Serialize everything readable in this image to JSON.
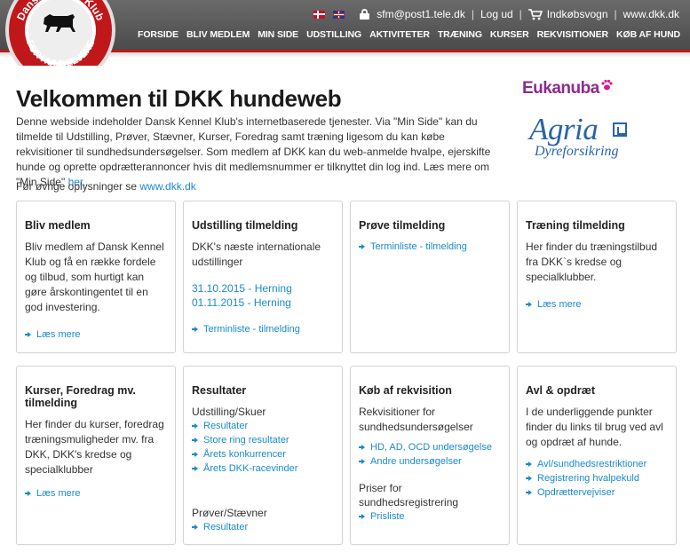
{
  "header": {
    "logo_text_top": "Dansk Kennel Klub",
    "logo_text_bottom": "FOR HUNDEEJERE",
    "user_email": "sfm@post1.tele.dk",
    "logout": "Log ud",
    "cart": "Indkøbsvogn",
    "site": "www.dkk.dk",
    "nav": [
      "FORSIDE",
      "BLIV MEDLEM",
      "MIN SIDE",
      "UDSTILLING",
      "AKTIVITETER",
      "TRÆNING",
      "KURSER",
      "REKVISITIONER",
      "KØB AF HUND"
    ]
  },
  "sponsors": {
    "eukanuba": "Eukanuba",
    "agria": "Agria",
    "agria_sub": "Dyreforsikring"
  },
  "main": {
    "title": "Velkommen til DKK hundeweb",
    "intro": "Denne webside indeholder Dansk Kennel Klub's internetbaserede tjenester. Via \"Min Side\" kan du tilmelde til Udstilling, Prøver, Stævner, Kurser, Foredrag samt træning ligesom du kan købe rekvisitioner til sundhedsundersøgelser. Som medlem af DKK kan du web-anmelde hvalpe, ejerskifte hunde og oprette opdrætterannoncer hvis dit medlemsnummer er tilknyttet din log ind. Læs mere om \"Min Side\"",
    "intro_link": "her.",
    "more_text": "Før øvrige oplysninger se",
    "more_link": "www.dkk.dk"
  },
  "cards": {
    "bliv": {
      "title": "Bliv medlem",
      "text": "Bliv medlem af Dansk Kennel Klub og få en række fordele og tilbud, som hurtigt kan gøre årskontingentet til en god investering.",
      "link": "Læs mere"
    },
    "udst": {
      "title": "Udstilling tilmelding",
      "text": "DKK's næste internationale udstillinger",
      "date1": "31.10.2015 - Herning",
      "date2": "01.11.2015 - Herning",
      "link": "Terminliste - tilmelding"
    },
    "prove": {
      "title": "Prøve tilmelding",
      "link": "Terminliste - tilmelding"
    },
    "traen": {
      "title": "Træning tilmelding",
      "text": "Her finder du træningstilbud fra DKK`s kredse og specialklubber.",
      "link": "Læs mere"
    },
    "kurser": {
      "title": "Kurser, Foredrag mv. tilmelding",
      "text": "Her finder du kurser, foredrag træningsmuligheder mv. fra DKK, DKK's kredse og specialklubber",
      "link": "Læs mere"
    },
    "result": {
      "title": "Resultater",
      "sub1": "Udstilling/Skuer",
      "links1": [
        "Resultater",
        "Store ring resultater",
        "Årets konkurrencer",
        "Årets DKK-racevinder"
      ],
      "sub2": "Prøver/Stævner",
      "links2": [
        "Resultater"
      ]
    },
    "kob": {
      "title": "Køb af rekvisition",
      "text": "Rekvisitioner for sundhedsundersøgelser",
      "links1": [
        "HD, AD, OCD undersøgelse",
        "Andre undersøgelser"
      ],
      "sub2": "Priser for sundhedsregistrering",
      "links2": [
        "Prisliste"
      ]
    },
    "avl": {
      "title": "Avl & opdræt",
      "text": "I de underliggende punkter finder du links til brug ved avl og opdræt af hunde.",
      "links": [
        "Avl/sundhedsrestriktioner",
        "Registrering hvalpekuld",
        "Opdrættervejviser"
      ]
    }
  },
  "colors": {
    "link": "#1a8acb",
    "header": "#555555",
    "brand_red": "#c0171b",
    "eukanuba": "#8c2b8e",
    "agria": "#2a63a8"
  }
}
